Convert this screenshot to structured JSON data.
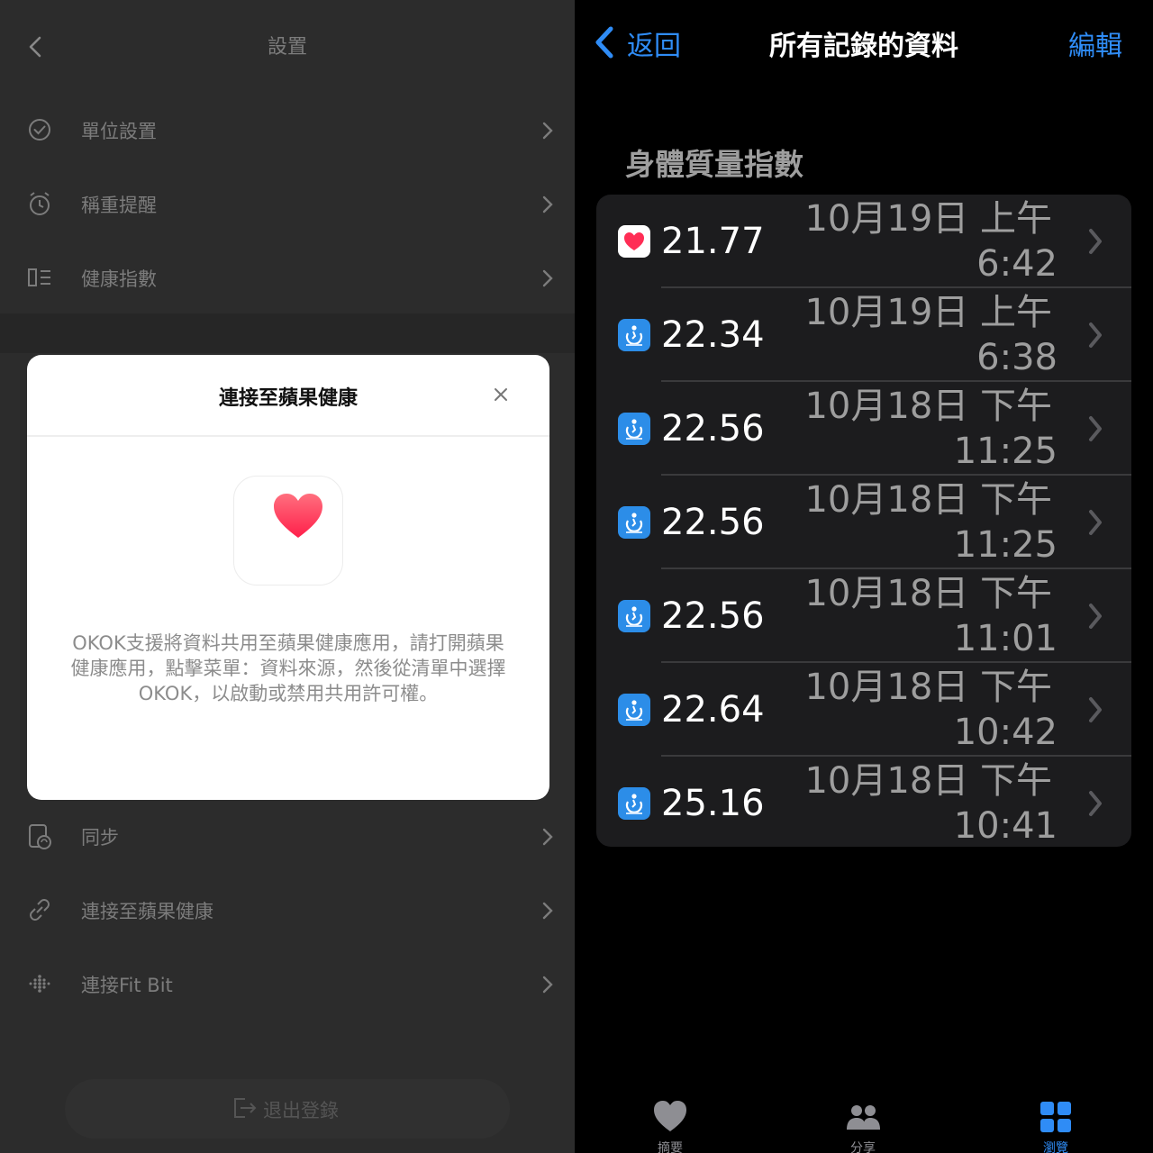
{
  "left": {
    "title": "設置",
    "rows_top": [
      {
        "label": "單位設置",
        "icon": "check-circle-icon"
      },
      {
        "label": "稱重提醒",
        "icon": "alarm-clock-icon"
      },
      {
        "label": "健康指數",
        "icon": "list-icon"
      }
    ],
    "rows_bottom": [
      {
        "label": "同步",
        "icon": "sync-icon"
      },
      {
        "label": "連接至蘋果健康",
        "icon": "link-icon"
      },
      {
        "label": "連接Fit Bit",
        "icon": "fitbit-dots-icon"
      }
    ],
    "logout_label": "退出登錄",
    "modal": {
      "title": "連接至蘋果健康",
      "body": "OKOK支援將資料共用至蘋果健康應用，請打開蘋果健康應用，點擊菜單：資料來源，然後從清單中選擇OKOK，以啟動或禁用共用許可權。"
    }
  },
  "right": {
    "nav": {
      "back_label": "返回",
      "title": "所有記錄的資料",
      "edit_label": "編輯"
    },
    "section_title": "身體質量指數",
    "records": [
      {
        "source": "apple-health",
        "value": "21.77",
        "date": "10月19日 上午",
        "time": "6:42"
      },
      {
        "source": "okok",
        "value": "22.34",
        "date": "10月19日 上午",
        "time": "6:38"
      },
      {
        "source": "okok",
        "value": "22.56",
        "date": "10月18日 下午",
        "time": "11:25"
      },
      {
        "source": "okok",
        "value": "22.56",
        "date": "10月18日 下午",
        "time": "11:25"
      },
      {
        "source": "okok",
        "value": "22.56",
        "date": "10月18日 下午",
        "time": "11:01"
      },
      {
        "source": "okok",
        "value": "22.64",
        "date": "10月18日 下午",
        "time": "10:42"
      },
      {
        "source": "okok",
        "value": "25.16",
        "date": "10月18日 下午",
        "time": "10:41"
      }
    ],
    "tabs": [
      {
        "label": "摘要",
        "icon": "heart-icon",
        "color": "#8e8e93"
      },
      {
        "label": "分享",
        "icon": "people-icon",
        "color": "#8e8e93"
      },
      {
        "label": "瀏覽",
        "icon": "grid-icon",
        "color": "#2f8cf6"
      }
    ]
  },
  "colors": {
    "accent_blue": "#2f8cf6",
    "okok_blue": "#2c8de8",
    "health_red": "#ff2d55"
  }
}
